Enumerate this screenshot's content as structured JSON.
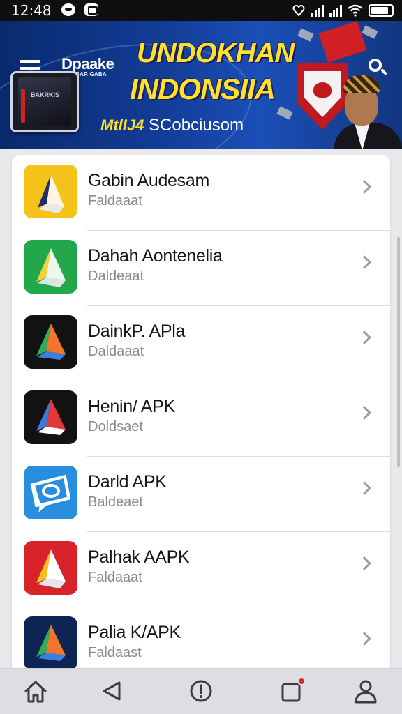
{
  "status_bar": {
    "time": "12:48",
    "icons": [
      "notification-icon",
      "message-icon",
      "vibrate-icon",
      "signal-icon",
      "signal-icon",
      "wifi-icon",
      "battery-icon"
    ]
  },
  "banner": {
    "brand_name": "Dpaake",
    "brand_subtitle": "MOMBAR GABA",
    "phone_screen_text": "BAKRKIS",
    "headline_line1": "UNDOKHAN",
    "headline_line2": "INDONSIIA",
    "tagline_part1": "MtlIJ4",
    "tagline_part2": "SCobciusom",
    "icons": [
      "menu-icon",
      "search-icon"
    ]
  },
  "apps": [
    {
      "name": "Gabin Audesam",
      "subtitle": "Faldaaat",
      "icon": "yellow-triangle-app-icon",
      "bg": "#f5c21a"
    },
    {
      "name": "Dahah Aontenelia",
      "subtitle": "Daldeaat",
      "icon": "green-triangle-app-icon",
      "bg": "#22a84a"
    },
    {
      "name": "DainkP. APla",
      "subtitle": "Daldaaat",
      "icon": "dark-triangle-app-icon",
      "bg": "#121212"
    },
    {
      "name": "Henin/ APK",
      "subtitle": "Doldsaet",
      "icon": "dark-red-triangle-app-icon",
      "bg": "#121212"
    },
    {
      "name": "Darld APK",
      "subtitle": "Baldeaet",
      "icon": "blue-chat-app-icon",
      "bg": "#2a8ee0"
    },
    {
      "name": "Palhak AAPK",
      "subtitle": "Faldaaat",
      "icon": "red-triangle-app-icon",
      "bg": "#d8232a"
    },
    {
      "name": "Palia K/APK",
      "subtitle": "Faldaast",
      "icon": "navy-triangle-app-icon",
      "bg": "#0e2553"
    }
  ],
  "bottom_nav": [
    "home-icon",
    "back-icon",
    "info-icon",
    "recents-icon",
    "profile-icon"
  ]
}
